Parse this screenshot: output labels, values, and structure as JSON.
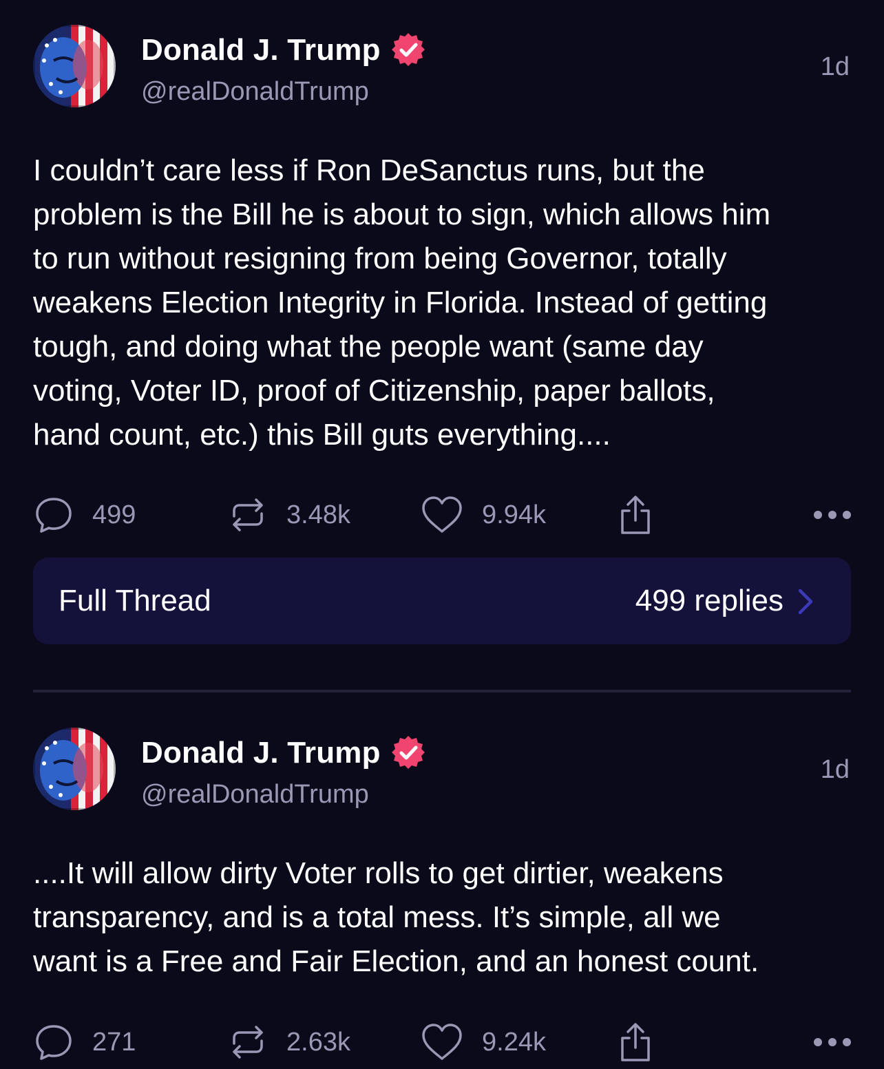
{
  "posts": [
    {
      "author": {
        "name": "Donald J. Trump",
        "handle": "@realDonaldTrump",
        "verified": true,
        "avatar": "flag-painted-face-avatar"
      },
      "time": "1d",
      "body": "I couldn’t care less if Ron DeSanctus runs, but the\nproblem is the Bill he is about to sign, which allows him\nto run without resigning from being Governor, totally\nweakens Election Integrity in Florida. Instead of getting\ntough, and doing what the people want (same day\nvoting, Voter ID, proof of Citizenship, paper ballots,\nhand count, etc.) this Bill guts everything....",
      "stats": {
        "replies": "499",
        "reposts": "3.48k",
        "likes": "9.94k"
      }
    },
    {
      "author": {
        "name": "Donald J. Trump",
        "handle": "@realDonaldTrump",
        "verified": true,
        "avatar": "flag-painted-face-avatar"
      },
      "time": "1d",
      "body": "....It will allow dirty Voter rolls to get dirtier, weakens\ntransparency, and is a total mess. It’s simple, all we\nwant is a Free and Fair Election, and an honest count.",
      "stats": {
        "replies": "271",
        "reposts": "2.63k",
        "likes": "9.24k"
      }
    }
  ],
  "thread": {
    "title": "Full Thread",
    "replies": "499 replies"
  },
  "icons": {
    "reply": "speech-bubble-icon",
    "repost": "repost-arrows-icon",
    "like": "heart-icon",
    "share": "share-upload-icon",
    "more": "more-dots-icon",
    "verified": "verified-badge-icon",
    "chevron": "chevron-right-icon"
  },
  "colors": {
    "background": "#0b0a1a",
    "muted_text": "#9a98b4",
    "verified_badge": "#f0456e",
    "thread_card": "#14123a",
    "chevron": "#3d3ab8"
  }
}
